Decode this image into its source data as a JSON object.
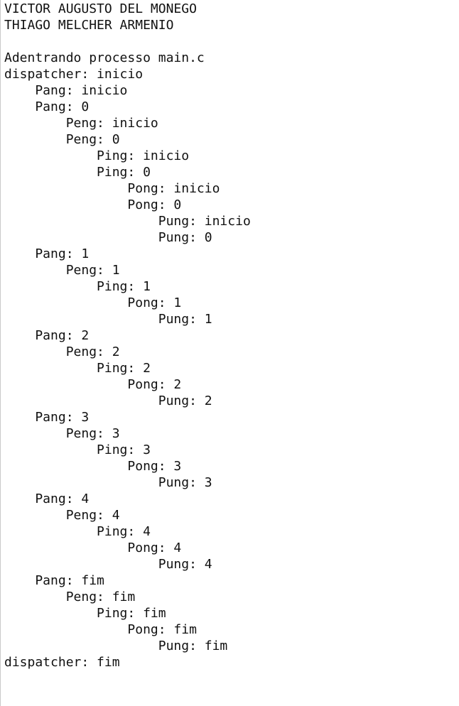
{
  "console": {
    "lines": [
      "VICTOR AUGUSTO DEL MONEGO",
      "THIAGO MELCHER ARMENIO",
      "",
      "Adentrando processo main.c",
      "dispatcher: inicio",
      "    Pang: inicio",
      "    Pang: 0",
      "        Peng: inicio",
      "        Peng: 0",
      "            Ping: inicio",
      "            Ping: 0",
      "                Pong: inicio",
      "                Pong: 0",
      "                    Pung: inicio",
      "                    Pung: 0",
      "    Pang: 1",
      "        Peng: 1",
      "            Ping: 1",
      "                Pong: 1",
      "                    Pung: 1",
      "    Pang: 2",
      "        Peng: 2",
      "            Ping: 2",
      "                Pong: 2",
      "                    Pung: 2",
      "    Pang: 3",
      "        Peng: 3",
      "            Ping: 3",
      "                Pong: 3",
      "                    Pung: 3",
      "    Pang: 4",
      "        Peng: 4",
      "            Ping: 4",
      "                Pong: 4",
      "                    Pung: 4",
      "    Pang: fim",
      "        Peng: fim",
      "            Ping: fim",
      "                Pong: fim",
      "                    Pung: fim",
      "dispatcher: fim"
    ]
  }
}
